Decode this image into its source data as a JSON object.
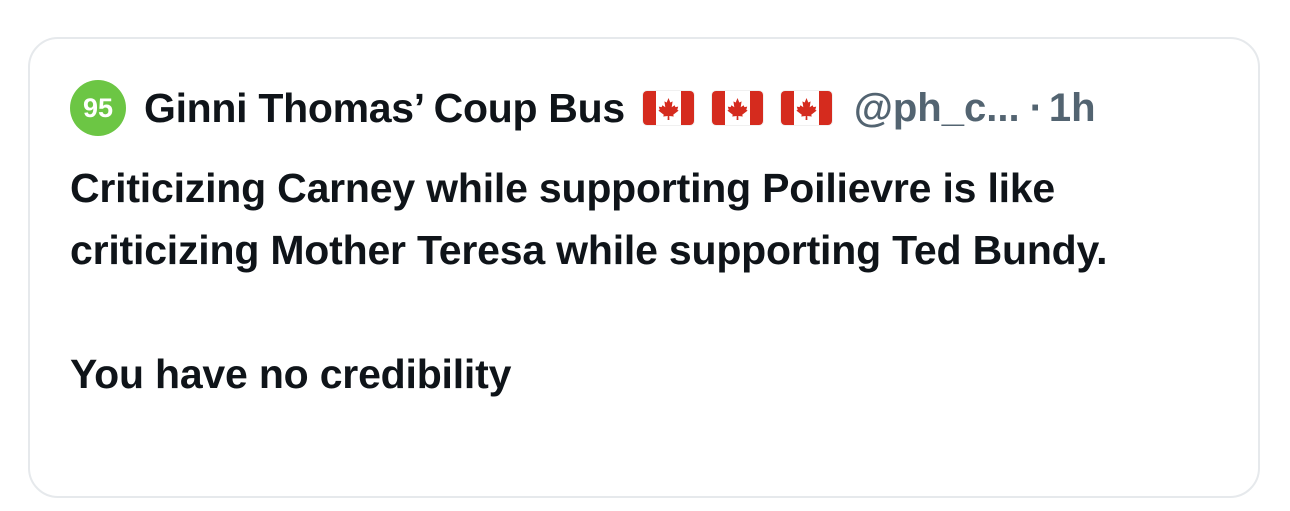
{
  "post": {
    "avatar_badge": "95",
    "avatar_color": "#6cc644",
    "display_name": "Ginni Thomas’ Coup Bus",
    "flags": [
      "canada-flag-icon",
      "canada-flag-icon",
      "canada-flag-icon"
    ],
    "handle": "@ph_c...",
    "separator": "·",
    "timestamp": "1h",
    "text_paragraph_1": "Criticizing Carney while supporting Poilievre is like criticizing Mother Teresa while supporting Ted Bundy.",
    "text_paragraph_2": "You have no credibility"
  }
}
